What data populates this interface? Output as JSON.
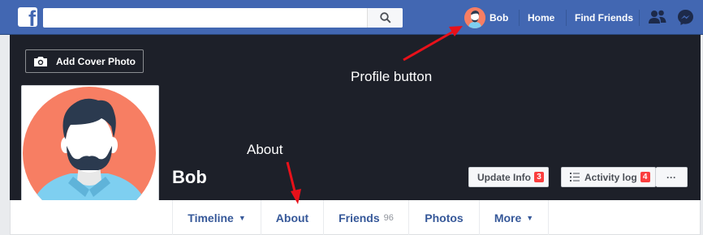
{
  "topbar": {
    "logo_letter": "f",
    "search_placeholder": "",
    "profile_name": "Bob",
    "home": "Home",
    "find_friends": "Find Friends",
    "icons": [
      "friend-requests-icon",
      "messenger-icon"
    ]
  },
  "cover": {
    "add_cover_photo": "Add Cover Photo"
  },
  "profile": {
    "name": "Bob"
  },
  "actions": {
    "update_info": "Update Info",
    "update_info_badge": "3",
    "activity_log": "Activity log",
    "activity_log_badge": "4",
    "more": "···"
  },
  "tabs": {
    "timeline": "Timeline",
    "about": "About",
    "friends": "Friends",
    "friends_count": "96",
    "photos": "Photos",
    "more": "More"
  },
  "annotations": {
    "profile_button": "Profile button",
    "about": "About"
  },
  "colors": {
    "brand_blue": "#4267b2",
    "cover_bg": "#1d2029",
    "annotation_arrow": "#e8111a",
    "avatar_bg": "#f77e63",
    "badge": "#fa3e3e"
  }
}
